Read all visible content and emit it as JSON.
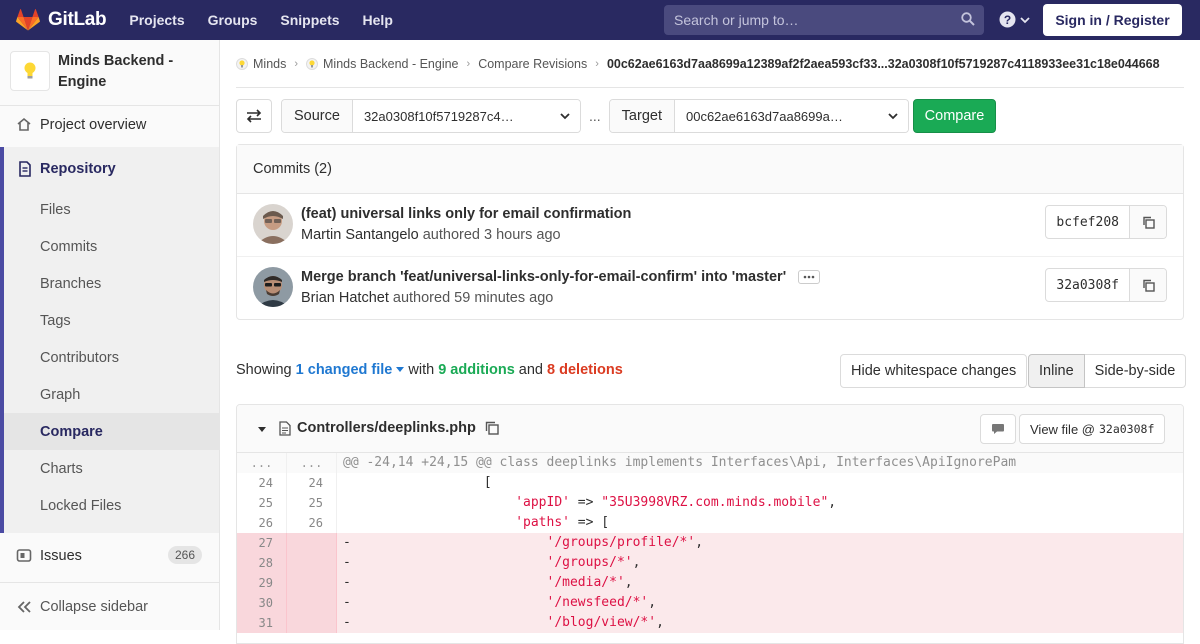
{
  "navbar": {
    "brand": "GitLab",
    "links": [
      "Projects",
      "Groups",
      "Snippets",
      "Help"
    ],
    "search_placeholder": "Search or jump to…",
    "sign_in": "Sign in / Register"
  },
  "sidebar": {
    "project_name_line1": "Minds Backend -",
    "project_name_line2": "Engine",
    "overview": "Project overview",
    "repository": "Repository",
    "repo_items": [
      "Files",
      "Commits",
      "Branches",
      "Tags",
      "Contributors",
      "Graph",
      "Compare",
      "Charts",
      "Locked Files"
    ],
    "issues": "Issues",
    "issues_count": "266",
    "collapse": "Collapse sidebar"
  },
  "breadcrumbs": {
    "group": "Minds",
    "project": "Minds Backend - Engine",
    "section": "Compare Revisions",
    "current": "00c62ae6163d7aa8699a12389af2f2aea593cf33...32a0308f10f5719287c4118933ee31c18e044668"
  },
  "compare": {
    "source_label": "Source",
    "source_value": "32a0308f10f5719287c4…",
    "ellipsis": "...",
    "target_label": "Target",
    "target_value": "00c62ae6163d7aa8699a…",
    "button": "Compare"
  },
  "commits": {
    "header": "Commits (2)",
    "items": [
      {
        "title": "(feat) universal links only for email confirmation",
        "author": "Martin Santangelo",
        "verb": "authored",
        "time": "3 hours ago",
        "sha": "bcfef208"
      },
      {
        "title": "Merge branch 'feat/universal-links-only-for-email-confirm' into 'master'",
        "author": "Brian Hatchet",
        "verb": "authored",
        "time": "59 minutes ago",
        "sha": "32a0308f"
      }
    ]
  },
  "stats": {
    "showing": "Showing",
    "changed": "1 changed file",
    "with": "with",
    "additions": "9 additions",
    "and": "and",
    "deletions": "8 deletions"
  },
  "diff_controls": {
    "hide_whitespace": "Hide whitespace changes",
    "inline": "Inline",
    "side_by_side": "Side-by-side"
  },
  "file": {
    "path": "Controllers/deeplinks.php",
    "view_file": "View file @",
    "view_sha": "32a0308f",
    "lines": [
      {
        "type": "match",
        "old": "...",
        "new": "...",
        "text": "@@ -24,14 +24,15 @@ class deeplinks implements Interfaces\\Api, Interfaces\\ApiIgnorePam"
      },
      {
        "type": "ctx",
        "old": "24",
        "new": "24",
        "text": "                  ["
      },
      {
        "type": "ctx",
        "old": "25",
        "new": "25",
        "text": "                      'appID' => \"35U3998VRZ.com.minds.mobile\","
      },
      {
        "type": "ctx",
        "old": "26",
        "new": "26",
        "text": "                      'paths' => ["
      },
      {
        "type": "old",
        "old": "27",
        "new": "",
        "text": "-                         '/groups/profile/*',"
      },
      {
        "type": "old",
        "old": "28",
        "new": "",
        "text": "-                         '/groups/*',"
      },
      {
        "type": "old",
        "old": "29",
        "new": "",
        "text": "-                         '/media/*',"
      },
      {
        "type": "old",
        "old": "30",
        "new": "",
        "text": "-                         '/newsfeed/*',"
      },
      {
        "type": "old",
        "old": "31",
        "new": "",
        "text": "-                         '/blog/view/*',"
      }
    ]
  }
}
